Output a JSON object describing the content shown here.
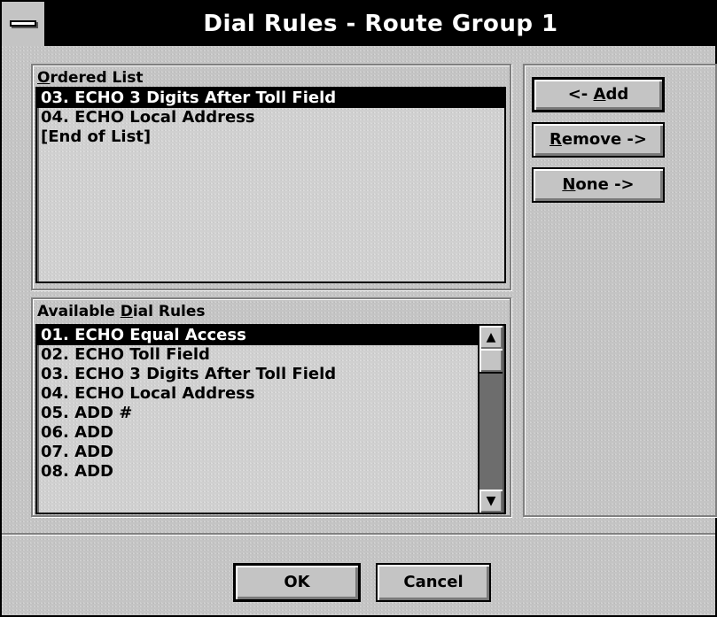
{
  "window": {
    "title": "Dial Rules - Route Group 1"
  },
  "ordered": {
    "label_pre": "",
    "label_mnemonic": "O",
    "label_post": "rdered List",
    "items": [
      {
        "text": "03.  ECHO 3 Digits After Toll Field",
        "selected": true
      },
      {
        "text": "04.  ECHO Local Address",
        "selected": false
      },
      {
        "text": "[End of List]",
        "selected": false
      }
    ]
  },
  "available": {
    "label_pre": "Available ",
    "label_mnemonic": "D",
    "label_post": "ial Rules",
    "items": [
      {
        "text": "01.  ECHO Equal Access",
        "selected": true
      },
      {
        "text": "02.  ECHO Toll Field",
        "selected": false
      },
      {
        "text": "03.  ECHO 3 Digits After Toll Field",
        "selected": false
      },
      {
        "text": "04.  ECHO Local Address",
        "selected": false
      },
      {
        "text": "05.  ADD #",
        "selected": false
      },
      {
        "text": "06.  ADD",
        "selected": false
      },
      {
        "text": "07.  ADD",
        "selected": false
      },
      {
        "text": "08.  ADD",
        "selected": false
      }
    ],
    "scroll_up": "▲",
    "scroll_down": "▼"
  },
  "buttons": {
    "add_pre": "<- ",
    "add_mnemonic": "A",
    "add_post": "dd",
    "remove_mnemonic": "R",
    "remove_post": "emove ->",
    "none_mnemonic": "N",
    "none_post": "one ->",
    "ok": "OK",
    "cancel": "Cancel"
  }
}
